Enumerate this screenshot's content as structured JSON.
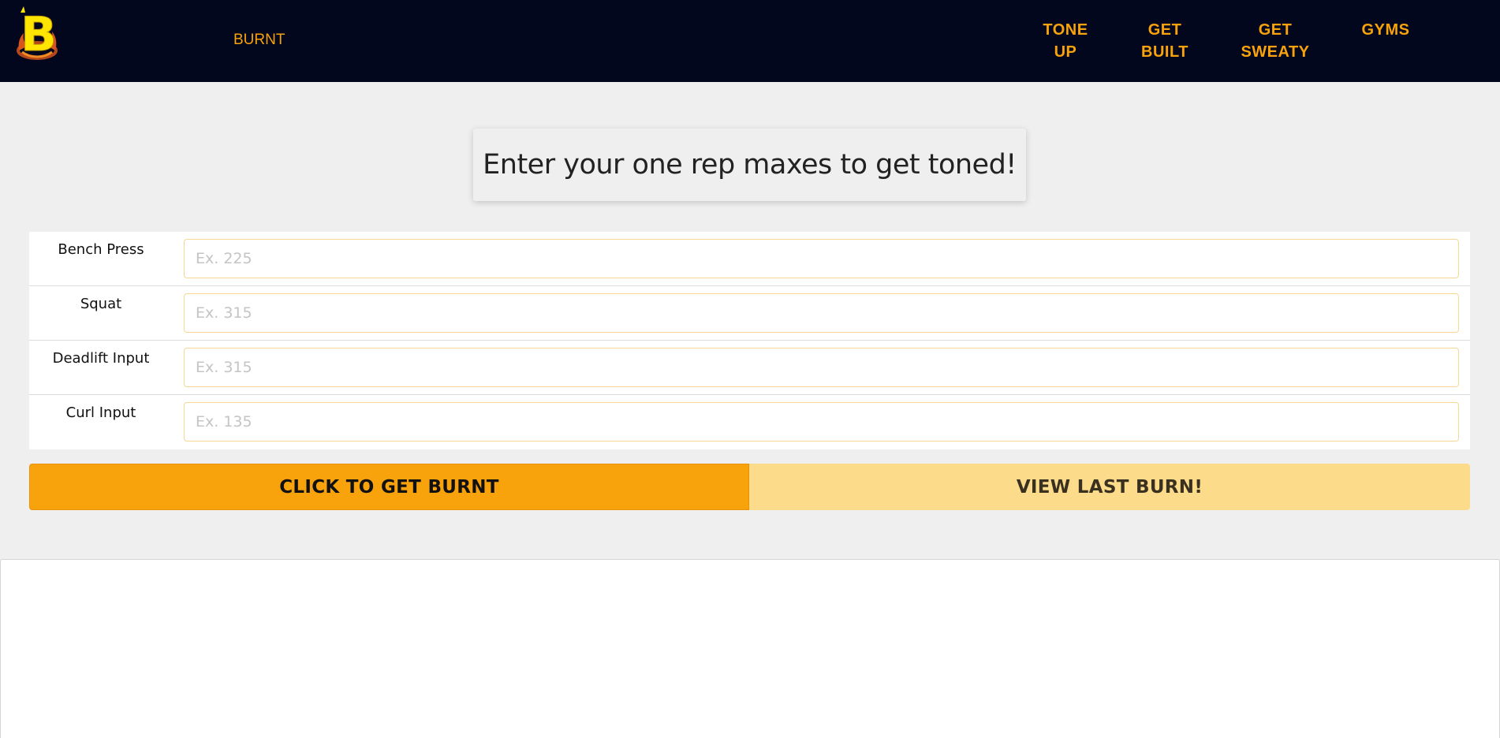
{
  "navbar": {
    "brand": "BURNT",
    "links": [
      {
        "label_line1": "TONE",
        "label_line2": "UP"
      },
      {
        "label_line1": "GET",
        "label_line2": "BUILT"
      },
      {
        "label_line1": "GET",
        "label_line2": "SWEATY"
      },
      {
        "label_line1": "GYMS",
        "label_line2": ""
      }
    ],
    "logo_icon": "flaming-b-logo",
    "colors": {
      "bg": "#03071e",
      "accent": "#f8a20c",
      "logo_yellow": "#ffe600"
    }
  },
  "heading": "Enter your one rep maxes to get toned!",
  "form": {
    "rows": [
      {
        "label": "Bench Press",
        "placeholder": "Ex. 225",
        "value": ""
      },
      {
        "label": "Squat",
        "placeholder": "Ex. 315",
        "value": ""
      },
      {
        "label": "Deadlift Input",
        "placeholder": "Ex. 315",
        "value": ""
      },
      {
        "label": "Curl Input",
        "placeholder": "Ex. 135",
        "value": ""
      }
    ]
  },
  "buttons": {
    "burn": "CLICK TO GET BURNT",
    "last_burn": "VIEW LAST BURN!"
  }
}
